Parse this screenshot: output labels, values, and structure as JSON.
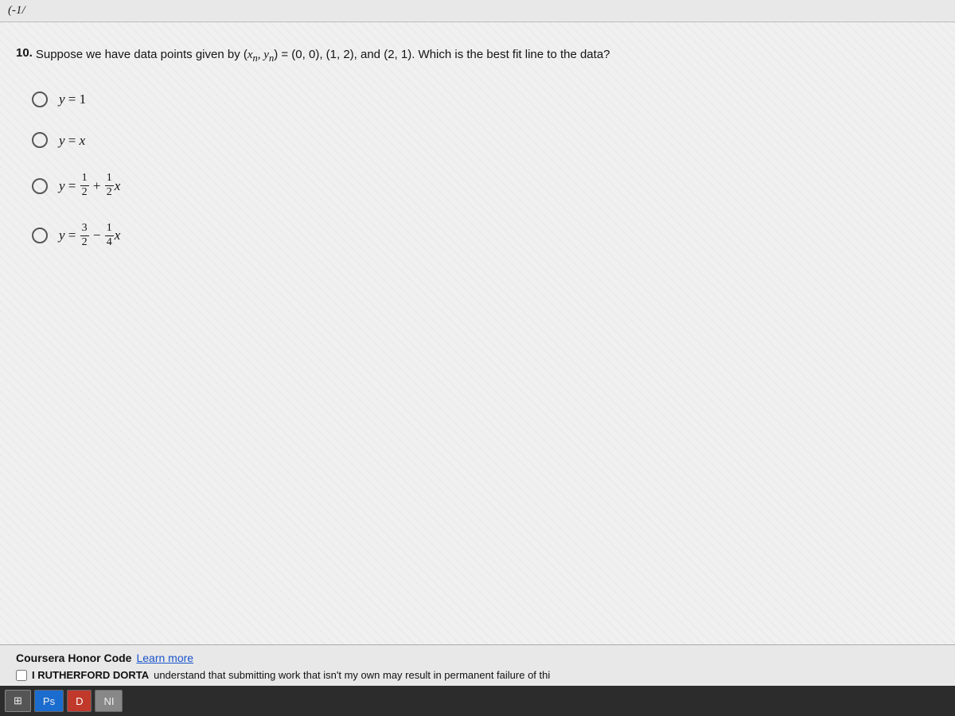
{
  "top_formula": "(-1/",
  "question": {
    "number": "10.",
    "text_before": "Suppose we have data points given by (",
    "math_xn": "x",
    "math_n": "n",
    "math_comma": ", ",
    "math_yn": "y",
    "math_n2": "n",
    "text_after": ") = (0, 0), (1, 2), and (2, 1). Which is the best fit line to the data?"
  },
  "options": [
    {
      "id": "opt1",
      "display": "y = 1",
      "type": "simple"
    },
    {
      "id": "opt2",
      "display": "y = x",
      "type": "simple"
    },
    {
      "id": "opt3",
      "display": "y = 1/2 + (1/2)x",
      "type": "fraction",
      "parts": {
        "lhs": "y",
        "eq": "=",
        "num1": "1",
        "den1": "2",
        "plus": "+",
        "num2": "1",
        "den2": "2",
        "var": "x"
      }
    },
    {
      "id": "opt4",
      "display": "y = 3/2 - (1/4)x",
      "type": "fraction",
      "parts": {
        "lhs": "y",
        "eq": "=",
        "num1": "3",
        "den1": "2",
        "minus": "−",
        "num2": "1",
        "den2": "4",
        "var": "x"
      }
    }
  ],
  "footer": {
    "honor_code_label": "Coursera Honor Code",
    "learn_more_text": "Learn more",
    "checkbox_bold": "I RUTHERFORD DORTA",
    "checkbox_rest": "understand that submitting work that isn't my own may result in permanent failure of thi"
  },
  "taskbar": {
    "start_label": "⊞",
    "ps_label": "Ps",
    "p_label": "D",
    "ni_label": "NI"
  }
}
